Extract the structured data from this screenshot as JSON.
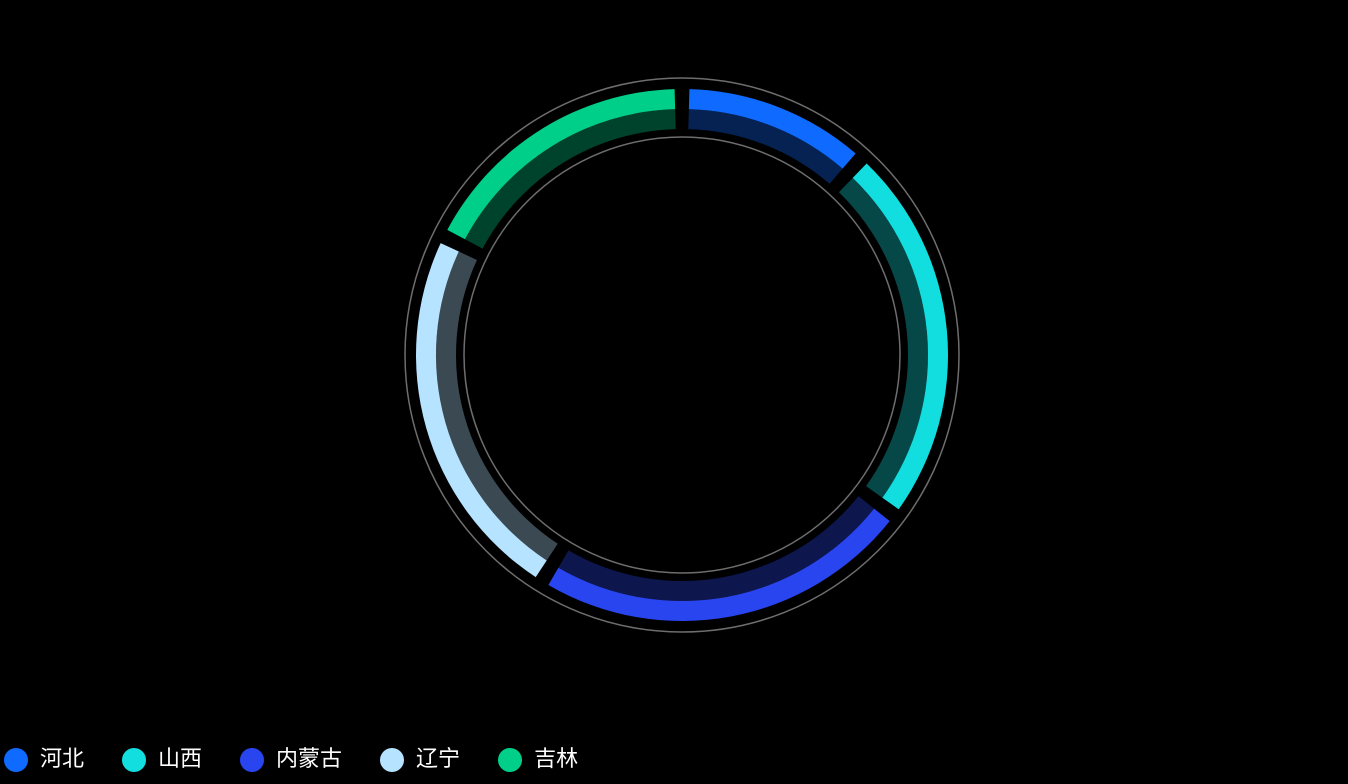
{
  "chart_data": {
    "type": "pie",
    "variant": "ring",
    "categories": [
      "河北",
      "山西",
      "内蒙古",
      "辽宁",
      "吉林"
    ],
    "values": [
      10,
      20,
      20,
      20,
      15
    ],
    "colors": [
      "#0f6bff",
      "#13dedf",
      "#2845f0",
      "#b6e3ff",
      "#00cf8a"
    ],
    "start_angle_deg": 0,
    "direction": "clockwise",
    "legend_position": "bottom-left",
    "legend": [
      "河北",
      "山西",
      "内蒙古",
      "辽宁",
      "吉林"
    ]
  }
}
